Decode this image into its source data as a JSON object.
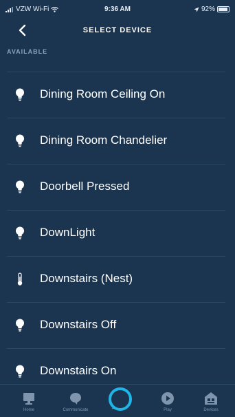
{
  "status_bar": {
    "carrier": "VZW Wi-Fi",
    "time": "9:36 AM",
    "battery": "92%",
    "battery_level": 0.92
  },
  "header": {
    "title": "SELECT DEVICE",
    "back_icon": "chevron-left-icon"
  },
  "section_label": "AVAILABLE",
  "devices": [
    {
      "label": "Dining Room Ceiling On",
      "icon": "lightbulb-icon"
    },
    {
      "label": "Dining Room Chandelier",
      "icon": "lightbulb-icon"
    },
    {
      "label": "Doorbell Pressed",
      "icon": "lightbulb-icon"
    },
    {
      "label": "DownLight",
      "icon": "lightbulb-icon"
    },
    {
      "label": "Downstairs (Nest)",
      "icon": "thermostat-icon"
    },
    {
      "label": "Downstairs Off",
      "icon": "lightbulb-icon"
    },
    {
      "label": "Downstairs On",
      "icon": "lightbulb-icon"
    }
  ],
  "tabs": [
    {
      "label": "Home",
      "icon": "home-icon"
    },
    {
      "label": "Communicate",
      "icon": "chat-bubble-icon"
    },
    {
      "label": "Play",
      "icon": "play-icon"
    },
    {
      "label": "Devices",
      "icon": "devices-icon"
    }
  ],
  "colors": {
    "background": "#1b3550",
    "alexa_accent": "#1fb5e6",
    "text": "#ffffff"
  }
}
